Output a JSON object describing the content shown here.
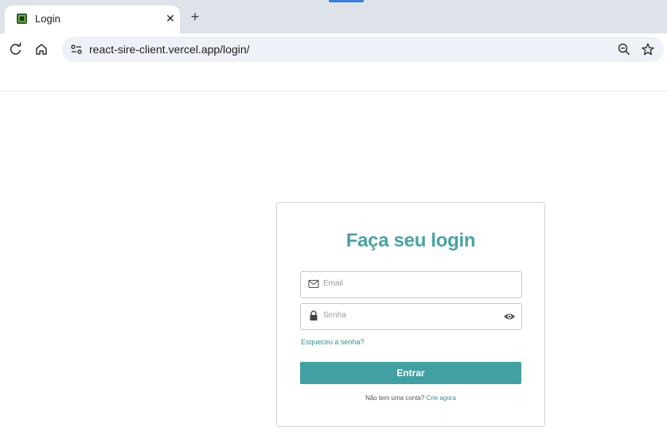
{
  "browser": {
    "tab_title": "Login",
    "tab_close": "✕",
    "new_tab": "+",
    "url": "react-sire-client.vercel.app/login/",
    "icons": [
      "favicon-icon",
      "close-icon",
      "plus-icon",
      "reload-icon",
      "home-icon",
      "site-info-icon",
      "zoom-icon",
      "star-icon"
    ]
  },
  "login": {
    "title": "Faça seu login",
    "email_placeholder": "Email",
    "password_placeholder": "Senha",
    "forgot_password": "Esqueceu a senha?",
    "submit": "Entrar",
    "no_account": "Não tem uma conta?",
    "create_now": "Crie agora",
    "accent_color": "#43a0a2"
  }
}
